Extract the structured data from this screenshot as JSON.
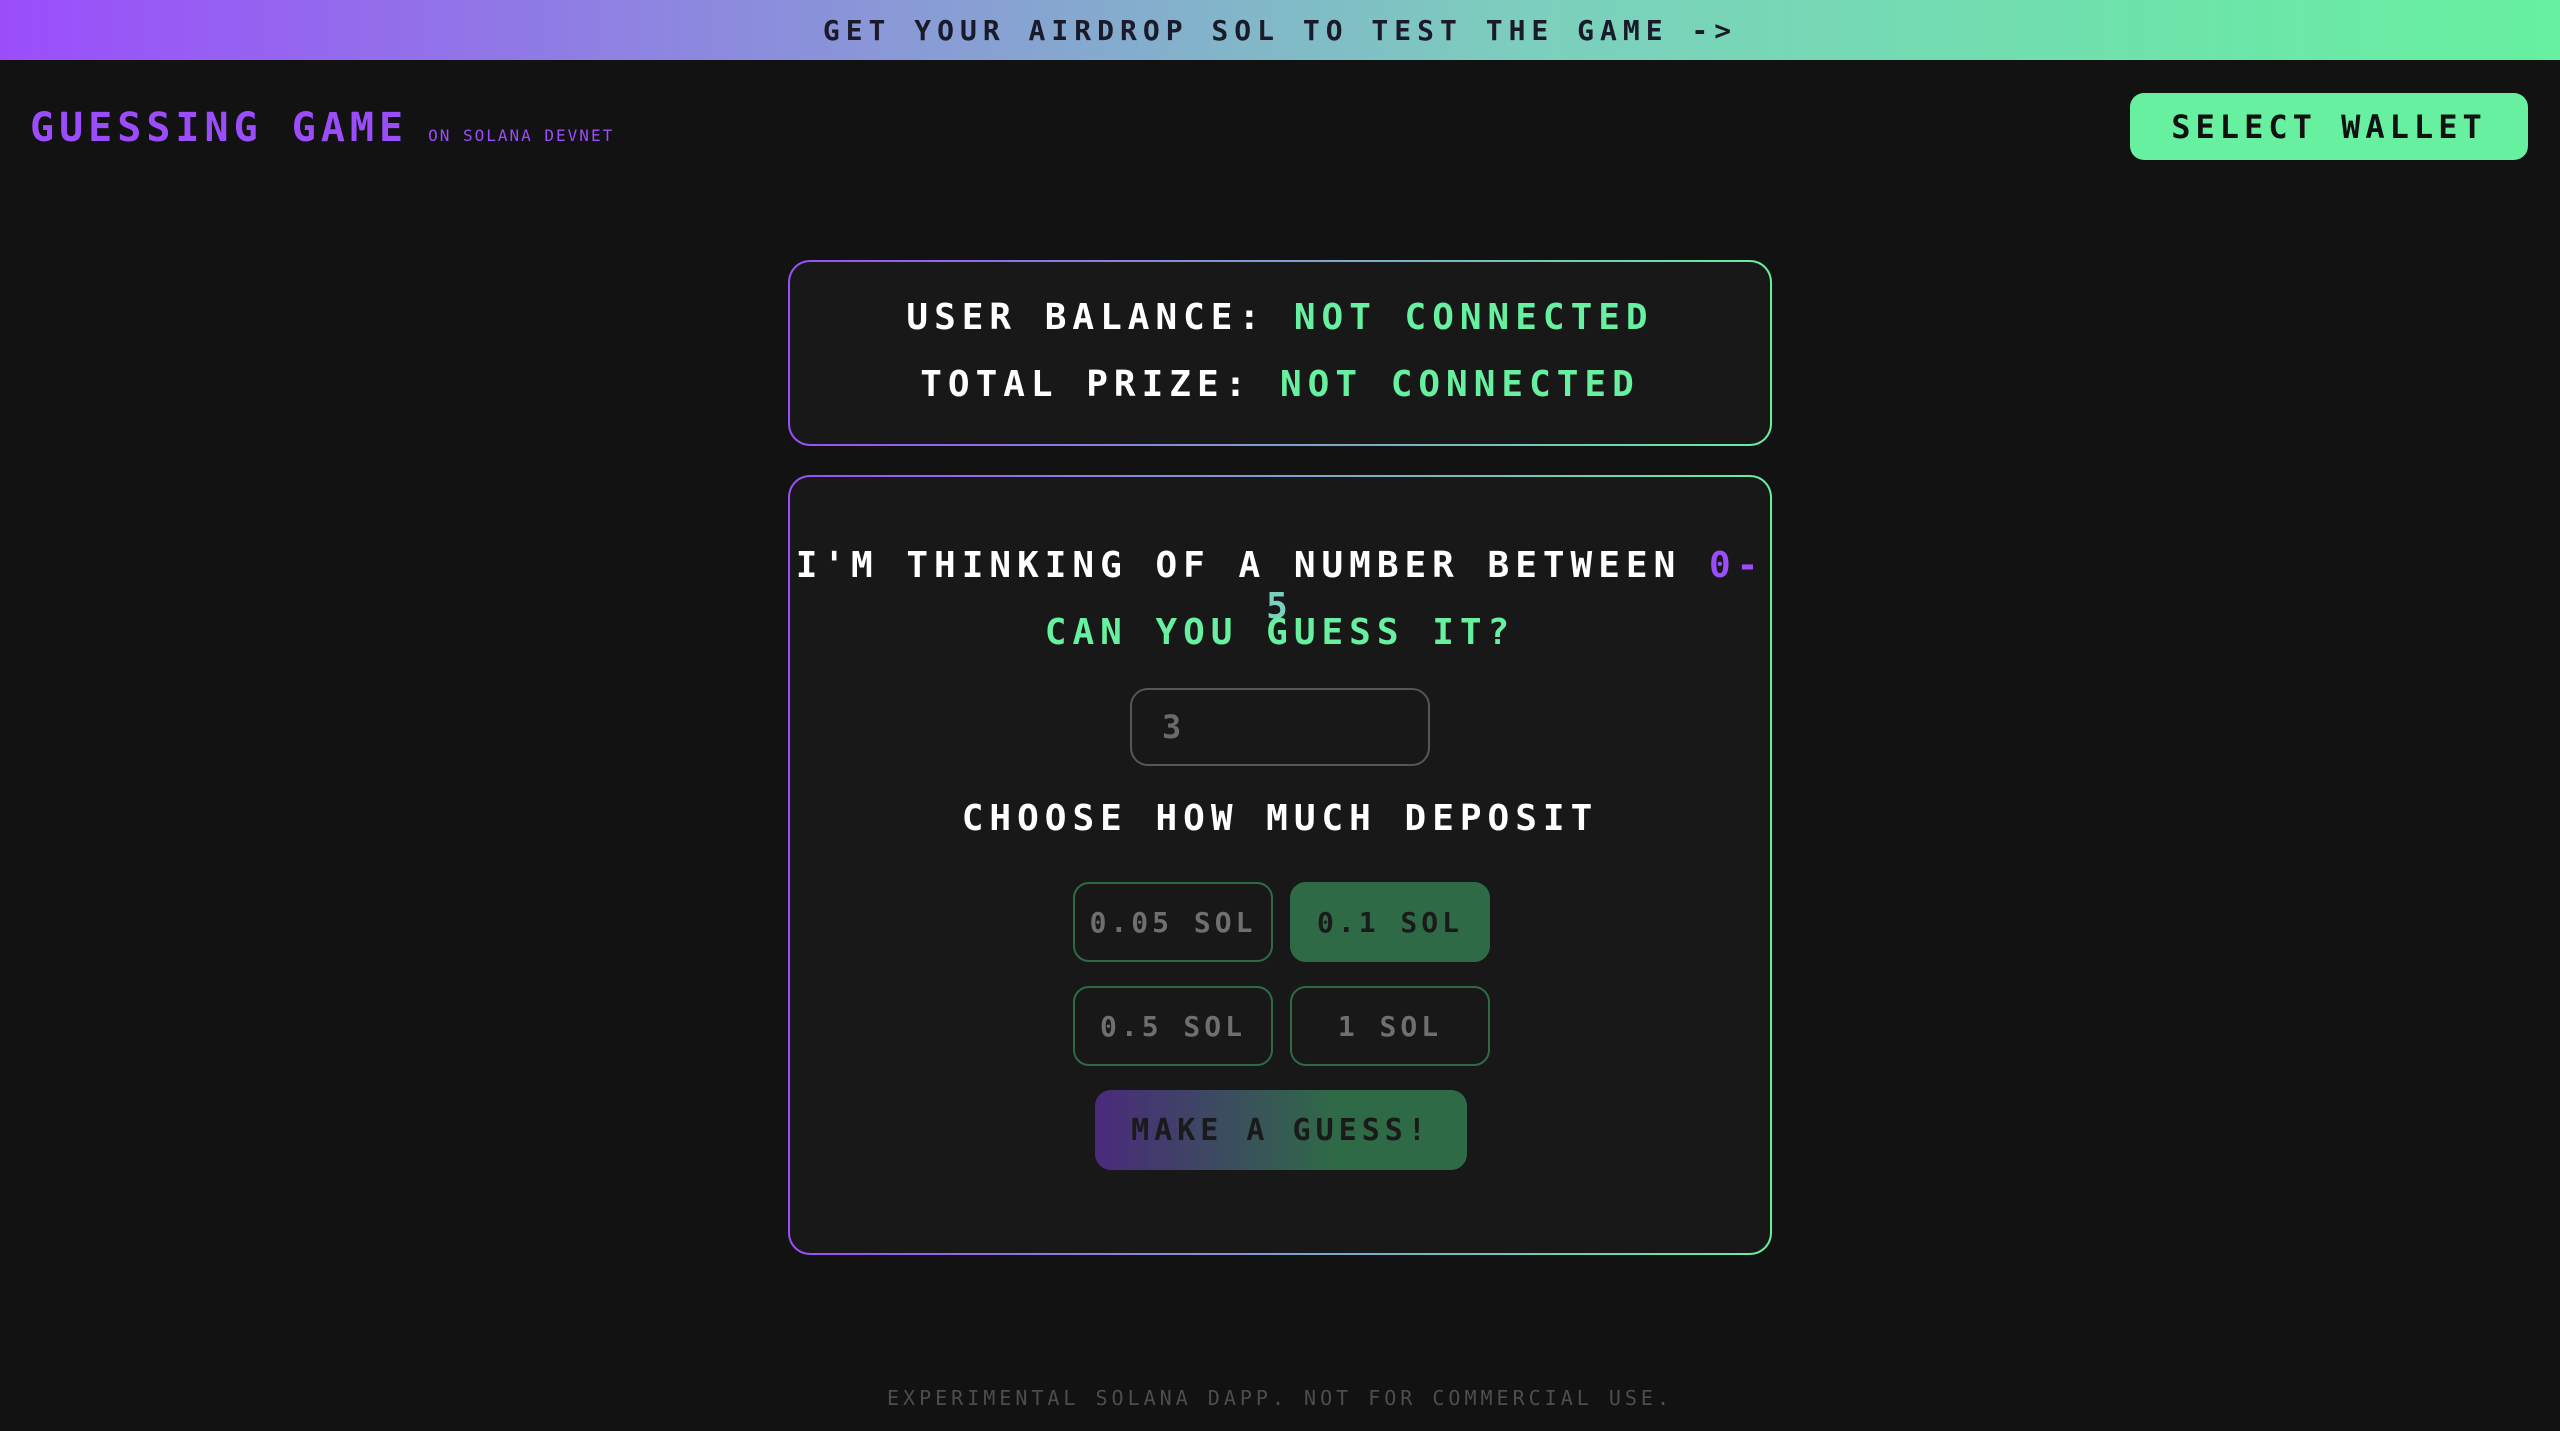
{
  "banner": {
    "text": "GET YOUR AIRDROP SOL TO TEST THE GAME ->"
  },
  "header": {
    "title": "GUESSING GAME",
    "subtitle": "ON SOLANA DEVNET",
    "wallet_button": "SELECT WALLET"
  },
  "balance_card": {
    "user_balance_label": "USER BALANCE:",
    "user_balance_value": "NOT CONNECTED",
    "total_prize_label": "TOTAL PRIZE:",
    "total_prize_value": "NOT CONNECTED"
  },
  "game_card": {
    "question_text": "I'M THINKING OF A NUMBER BETWEEN",
    "range_start": "0-",
    "range_end": "5",
    "can_guess": "CAN YOU GUESS IT?",
    "guess_input": {
      "placeholder": "3",
      "value": ""
    },
    "deposit_label": "CHOOSE HOW MUCH DEPOSIT",
    "amounts": [
      {
        "label": "0.05 SOL",
        "selected": false
      },
      {
        "label": "0.1 SOL",
        "selected": true
      },
      {
        "label": "0.5 SOL",
        "selected": false
      },
      {
        "label": "1 SOL",
        "selected": false
      }
    ],
    "submit_button": "MAKE A GUESS!"
  },
  "footer": {
    "text": "EXPERIMENTAL SOLANA DAPP. NOT FOR COMMERCIAL USE."
  },
  "colors": {
    "purple": "#9b4dfb",
    "green": "#66f0a0",
    "teal": "#7ccfbd",
    "background": "#121212",
    "card": "#181818"
  }
}
